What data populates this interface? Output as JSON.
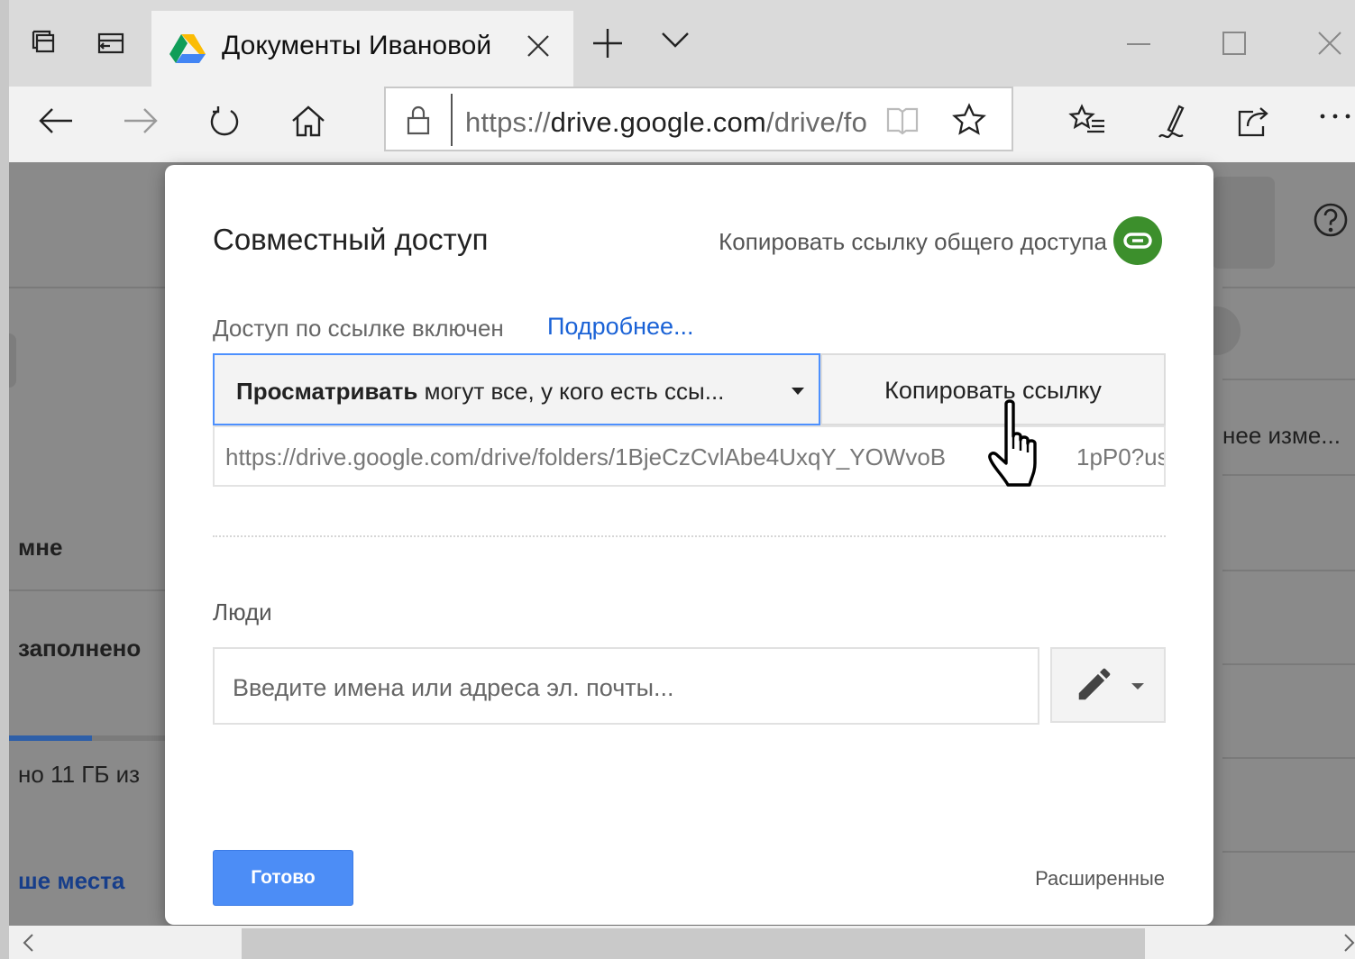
{
  "browser": {
    "tab_title": "Документы Ивановой",
    "url_prefix": "https://",
    "url_domain": "drive.google.com",
    "url_rest": "/drive/fo"
  },
  "background": {
    "items": [
      "нее изме...",
      "мне",
      "заполнено",
      "но 11 ГБ из",
      "ше места"
    ]
  },
  "dialog": {
    "title": "Совместный доступ",
    "copy_share_link": "Копировать ссылку общего доступа",
    "access_status": "Доступ по ссылке включен",
    "learn_more": "Подробнее...",
    "permission_bold": "Просматривать",
    "permission_rest": " могут все, у кого есть ссы...",
    "copy_link_button": "Копировать ссылку",
    "share_url": "https://drive.google.com/drive/folders/1BjeCzCvlAbe4UxqY_YOWvoB",
    "share_url_tail": "1pP0?us",
    "people_label": "Люди",
    "people_placeholder": "Введите имена или адреса эл. почты...",
    "done_button": "Готово",
    "advanced_link": "Расширенные"
  },
  "colors": {
    "accent_blue": "#4c8df6",
    "link_blue": "#1a62d6",
    "share_green": "#3c8f2c"
  }
}
